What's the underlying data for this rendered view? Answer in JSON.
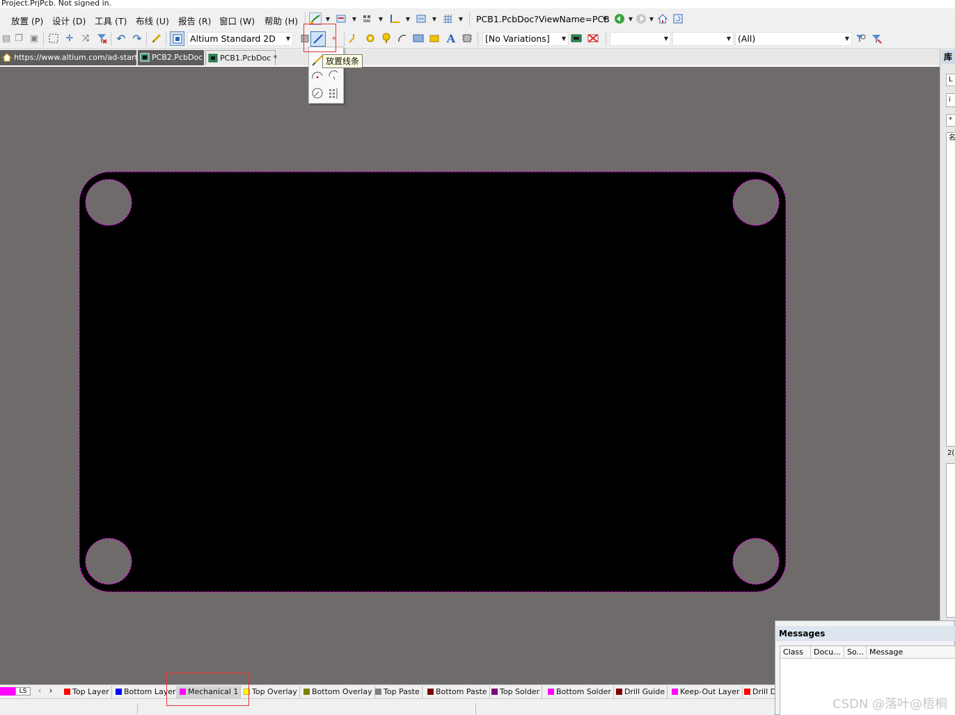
{
  "title_strip": "Project.PrjPcb. Not signed in.",
  "menu": [
    {
      "label": "放置 (P)"
    },
    {
      "label": "设计 (D)"
    },
    {
      "label": "工具 (T)"
    },
    {
      "label": "布线 (U)"
    },
    {
      "label": "报告 (R)"
    },
    {
      "label": "窗口 (W)"
    },
    {
      "label": "帮助 (H)"
    }
  ],
  "toolbar": {
    "document_path": "PCB1.PcbDoc?ViewName=PCBE",
    "view_mode": "Altium Standard 2D",
    "variations": "[No Variations]",
    "filter_blank_1": "",
    "filter_blank_2": "",
    "filter_all": "(All)"
  },
  "tabs": [
    {
      "label": "https://www.altium.com/ad-start/"
    },
    {
      "label": "PCB2.PcbDoc"
    },
    {
      "label": "PCB1.PcbDoc *"
    }
  ],
  "tooltip": "放置线条",
  "right_panel": {
    "title": "库",
    "box1": "L",
    "box2": "i",
    "box3": "*",
    "box4": "名",
    "count": "2("
  },
  "messages": {
    "title": "Messages",
    "columns": [
      "Class",
      "Docu...",
      "So...",
      "Message"
    ]
  },
  "layer_controls": {
    "ls_label": "LS",
    "prev": "‹",
    "next": "›"
  },
  "layers": [
    {
      "label": "Top Layer",
      "color": "#ff0000"
    },
    {
      "label": "Bottom Layer",
      "color": "#0000ff"
    },
    {
      "label": "Mechanical 1",
      "color": "#ff00ff",
      "active": true
    },
    {
      "label": "Top Overlay",
      "color": "#ffff00"
    },
    {
      "label": "Bottom Overlay",
      "color": "#808000"
    },
    {
      "label": "Top Paste",
      "color": "#808080"
    },
    {
      "label": "Bottom Paste",
      "color": "#800000"
    },
    {
      "label": "Top Solder",
      "color": "#800080"
    },
    {
      "label": "Bottom Solder",
      "color": "#ff00ff"
    },
    {
      "label": "Drill Guide",
      "color": "#800000"
    },
    {
      "label": "Keep-Out Layer",
      "color": "#ff00ff"
    },
    {
      "label": "Drill D",
      "color": "#ff0000"
    }
  ],
  "colors": {
    "canvas": "#706b6b",
    "board": "#000000",
    "outline": "#ff00ff",
    "highlight": "#e53333"
  },
  "watermark": "CSDN @落叶@梧桐"
}
